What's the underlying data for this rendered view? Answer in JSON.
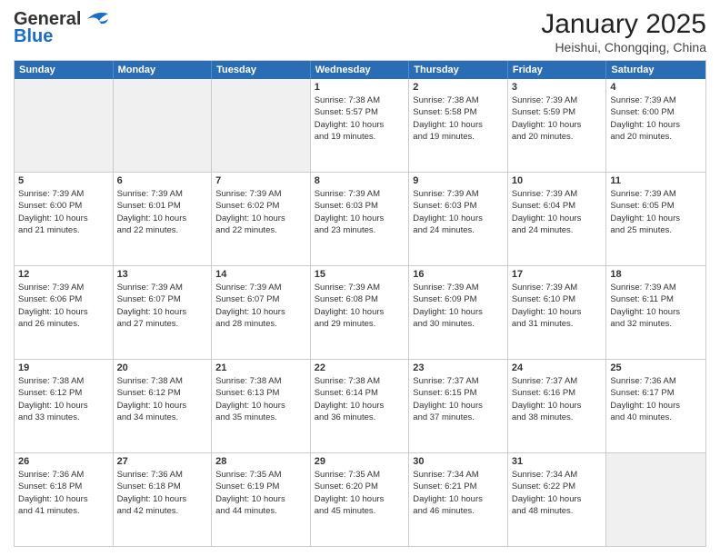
{
  "logo": {
    "line1": "General",
    "line2": "Blue"
  },
  "title": "January 2025",
  "subtitle": "Heishui, Chongqing, China",
  "header_days": [
    "Sunday",
    "Monday",
    "Tuesday",
    "Wednesday",
    "Thursday",
    "Friday",
    "Saturday"
  ],
  "rows": [
    [
      {
        "day": "",
        "lines": [],
        "shaded": true
      },
      {
        "day": "",
        "lines": [],
        "shaded": true
      },
      {
        "day": "",
        "lines": [],
        "shaded": true
      },
      {
        "day": "1",
        "lines": [
          "Sunrise: 7:38 AM",
          "Sunset: 5:57 PM",
          "Daylight: 10 hours",
          "and 19 minutes."
        ]
      },
      {
        "day": "2",
        "lines": [
          "Sunrise: 7:38 AM",
          "Sunset: 5:58 PM",
          "Daylight: 10 hours",
          "and 19 minutes."
        ]
      },
      {
        "day": "3",
        "lines": [
          "Sunrise: 7:39 AM",
          "Sunset: 5:59 PM",
          "Daylight: 10 hours",
          "and 20 minutes."
        ]
      },
      {
        "day": "4",
        "lines": [
          "Sunrise: 7:39 AM",
          "Sunset: 6:00 PM",
          "Daylight: 10 hours",
          "and 20 minutes."
        ]
      }
    ],
    [
      {
        "day": "5",
        "lines": [
          "Sunrise: 7:39 AM",
          "Sunset: 6:00 PM",
          "Daylight: 10 hours",
          "and 21 minutes."
        ]
      },
      {
        "day": "6",
        "lines": [
          "Sunrise: 7:39 AM",
          "Sunset: 6:01 PM",
          "Daylight: 10 hours",
          "and 22 minutes."
        ]
      },
      {
        "day": "7",
        "lines": [
          "Sunrise: 7:39 AM",
          "Sunset: 6:02 PM",
          "Daylight: 10 hours",
          "and 22 minutes."
        ]
      },
      {
        "day": "8",
        "lines": [
          "Sunrise: 7:39 AM",
          "Sunset: 6:03 PM",
          "Daylight: 10 hours",
          "and 23 minutes."
        ]
      },
      {
        "day": "9",
        "lines": [
          "Sunrise: 7:39 AM",
          "Sunset: 6:03 PM",
          "Daylight: 10 hours",
          "and 24 minutes."
        ]
      },
      {
        "day": "10",
        "lines": [
          "Sunrise: 7:39 AM",
          "Sunset: 6:04 PM",
          "Daylight: 10 hours",
          "and 24 minutes."
        ]
      },
      {
        "day": "11",
        "lines": [
          "Sunrise: 7:39 AM",
          "Sunset: 6:05 PM",
          "Daylight: 10 hours",
          "and 25 minutes."
        ]
      }
    ],
    [
      {
        "day": "12",
        "lines": [
          "Sunrise: 7:39 AM",
          "Sunset: 6:06 PM",
          "Daylight: 10 hours",
          "and 26 minutes."
        ]
      },
      {
        "day": "13",
        "lines": [
          "Sunrise: 7:39 AM",
          "Sunset: 6:07 PM",
          "Daylight: 10 hours",
          "and 27 minutes."
        ]
      },
      {
        "day": "14",
        "lines": [
          "Sunrise: 7:39 AM",
          "Sunset: 6:07 PM",
          "Daylight: 10 hours",
          "and 28 minutes."
        ]
      },
      {
        "day": "15",
        "lines": [
          "Sunrise: 7:39 AM",
          "Sunset: 6:08 PM",
          "Daylight: 10 hours",
          "and 29 minutes."
        ]
      },
      {
        "day": "16",
        "lines": [
          "Sunrise: 7:39 AM",
          "Sunset: 6:09 PM",
          "Daylight: 10 hours",
          "and 30 minutes."
        ]
      },
      {
        "day": "17",
        "lines": [
          "Sunrise: 7:39 AM",
          "Sunset: 6:10 PM",
          "Daylight: 10 hours",
          "and 31 minutes."
        ]
      },
      {
        "day": "18",
        "lines": [
          "Sunrise: 7:39 AM",
          "Sunset: 6:11 PM",
          "Daylight: 10 hours",
          "and 32 minutes."
        ]
      }
    ],
    [
      {
        "day": "19",
        "lines": [
          "Sunrise: 7:38 AM",
          "Sunset: 6:12 PM",
          "Daylight: 10 hours",
          "and 33 minutes."
        ]
      },
      {
        "day": "20",
        "lines": [
          "Sunrise: 7:38 AM",
          "Sunset: 6:12 PM",
          "Daylight: 10 hours",
          "and 34 minutes."
        ]
      },
      {
        "day": "21",
        "lines": [
          "Sunrise: 7:38 AM",
          "Sunset: 6:13 PM",
          "Daylight: 10 hours",
          "and 35 minutes."
        ]
      },
      {
        "day": "22",
        "lines": [
          "Sunrise: 7:38 AM",
          "Sunset: 6:14 PM",
          "Daylight: 10 hours",
          "and 36 minutes."
        ]
      },
      {
        "day": "23",
        "lines": [
          "Sunrise: 7:37 AM",
          "Sunset: 6:15 PM",
          "Daylight: 10 hours",
          "and 37 minutes."
        ]
      },
      {
        "day": "24",
        "lines": [
          "Sunrise: 7:37 AM",
          "Sunset: 6:16 PM",
          "Daylight: 10 hours",
          "and 38 minutes."
        ]
      },
      {
        "day": "25",
        "lines": [
          "Sunrise: 7:36 AM",
          "Sunset: 6:17 PM",
          "Daylight: 10 hours",
          "and 40 minutes."
        ]
      }
    ],
    [
      {
        "day": "26",
        "lines": [
          "Sunrise: 7:36 AM",
          "Sunset: 6:18 PM",
          "Daylight: 10 hours",
          "and 41 minutes."
        ]
      },
      {
        "day": "27",
        "lines": [
          "Sunrise: 7:36 AM",
          "Sunset: 6:18 PM",
          "Daylight: 10 hours",
          "and 42 minutes."
        ]
      },
      {
        "day": "28",
        "lines": [
          "Sunrise: 7:35 AM",
          "Sunset: 6:19 PM",
          "Daylight: 10 hours",
          "and 44 minutes."
        ]
      },
      {
        "day": "29",
        "lines": [
          "Sunrise: 7:35 AM",
          "Sunset: 6:20 PM",
          "Daylight: 10 hours",
          "and 45 minutes."
        ]
      },
      {
        "day": "30",
        "lines": [
          "Sunrise: 7:34 AM",
          "Sunset: 6:21 PM",
          "Daylight: 10 hours",
          "and 46 minutes."
        ]
      },
      {
        "day": "31",
        "lines": [
          "Sunrise: 7:34 AM",
          "Sunset: 6:22 PM",
          "Daylight: 10 hours",
          "and 48 minutes."
        ]
      },
      {
        "day": "",
        "lines": [],
        "shaded": true
      }
    ]
  ]
}
